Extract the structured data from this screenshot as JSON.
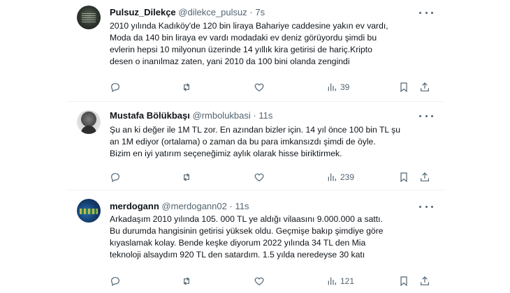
{
  "tweets": [
    {
      "name": "Pulsuz_Dilekçe",
      "handle": "@dilekce_pulsuz",
      "dot": "·",
      "time": "7s",
      "lines": [
        "2010 yılında Kadıköy'de 120 bin liraya Bahariye caddesine yakın ev vardı,",
        "Moda da 140 bin liraya ev vardı modadaki ev deniz görüyordu şimdi bu",
        "evlerin hepsi 10 milyonun üzerinde 14 yıllık kira getirisi de hariç.Kripto",
        "desen o inanılmaz zaten, yani 2010 da 100 bini olanda zengindi"
      ],
      "views": "39"
    },
    {
      "name": "Mustafa Bölükbaşı",
      "handle": "@rmbolukbasi",
      "dot": "·",
      "time": "11s",
      "lines": [
        "Şu an ki değer ile 1M TL zor. En azından bizler için. 14 yıl önce 100 bin TL şu",
        "an 1M ediyor (ortalama) o zaman da bu para imkansızdı şimdi de öyle.",
        "Bizim en iyi yatırım seçeneğimiz aylık olarak hisse biriktirmek."
      ],
      "views": "239"
    },
    {
      "name": "merdogann",
      "handle": "@merdogann02",
      "dot": "·",
      "time": "11s",
      "lines": [
        "Arkadaşım 2010 yılında 105. 000 TL ye aldığı vilaasını 9.000.000 a sattı.",
        "Bu durumda hangisinin getirisi yüksek oldu. Geçmişe bakıp şimdiye göre",
        "kıyaslamak kolay. Bende keşke diyorum 2022 yılında 34 TL den Mia",
        "teknoloji alsaydım 920 TL den satardım. 1.5 yılda neredeyse 30 katı"
      ],
      "views": "121"
    }
  ],
  "icons": {
    "reply": "reply-icon",
    "retweet": "retweet-icon",
    "like": "heart-icon",
    "views": "analytics-icon",
    "bookmark": "bookmark-icon",
    "share": "share-icon",
    "more": "more-icon"
  },
  "colors": {
    "text": "#0f1419",
    "secondary": "#536471",
    "divider": "#eff3f4"
  }
}
